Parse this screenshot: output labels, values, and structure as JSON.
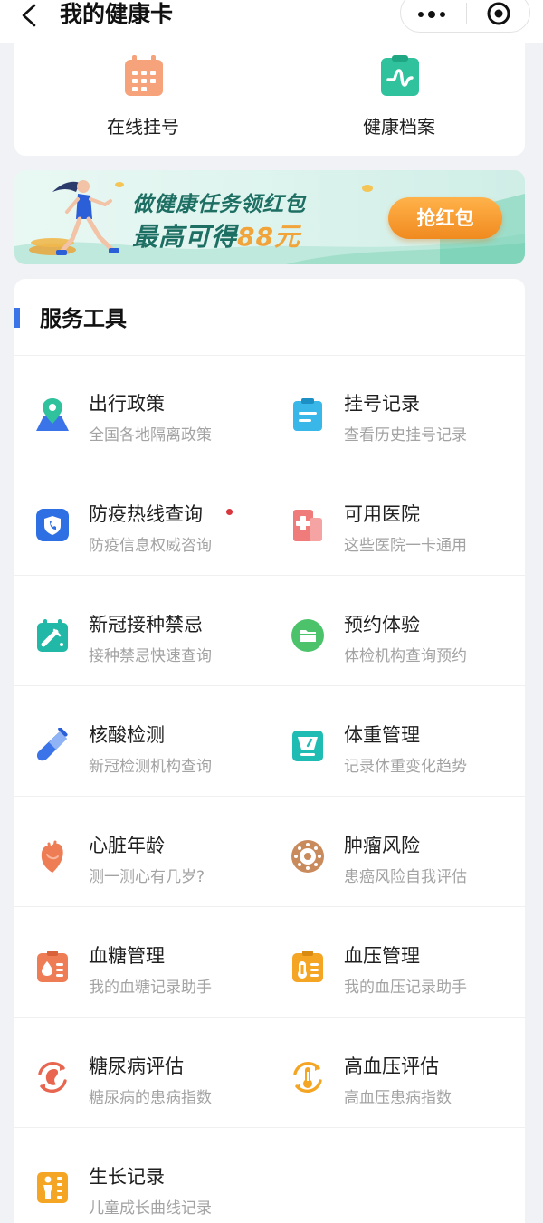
{
  "nav": {
    "title": "我的健康卡"
  },
  "quick": [
    {
      "label": "在线挂号",
      "icon": "calendar-icon",
      "color": "#f6a27a"
    },
    {
      "label": "健康档案",
      "icon": "health-record-icon",
      "color": "#2fc29d"
    }
  ],
  "banner": {
    "line1": "做健康任务领红包",
    "line2_prefix": "最高可得",
    "line2_amount": "88元",
    "button": "抢红包"
  },
  "tools": {
    "title": "服务工具",
    "items": [
      {
        "name": "出行政策",
        "desc": "全国各地隔离政策",
        "icon": "map-pin-icon",
        "color": "#3b73e8"
      },
      {
        "name": "挂号记录",
        "desc": "查看历史挂号记录",
        "icon": "clipboard-icon",
        "color": "#39b7e8"
      },
      {
        "name": "防疫热线查询",
        "desc": "防疫信息权威咨询",
        "icon": "phone-shield-icon",
        "color": "#2f6fe4",
        "dot": true
      },
      {
        "name": "可用医院",
        "desc": "这些医院一卡通用",
        "icon": "hospital-icon",
        "color": "#f07b7b"
      },
      {
        "name": "新冠接种禁忌",
        "desc": "接种禁忌快速查询",
        "icon": "vaccine-calendar-icon",
        "color": "#21b8a8"
      },
      {
        "name": "预约体验",
        "desc": "体检机构查询预约",
        "icon": "folder-icon",
        "color": "#4cc36a"
      },
      {
        "name": "核酸检测",
        "desc": "新冠检测机构查询",
        "icon": "test-tube-icon",
        "color": "#3b73e8"
      },
      {
        "name": "体重管理",
        "desc": "记录体重变化趋势",
        "icon": "scale-icon",
        "color": "#1fbcb4"
      },
      {
        "name": "心脏年龄",
        "desc": "测一测心有几岁?",
        "icon": "heart-icon",
        "color": "#ee7d55"
      },
      {
        "name": "肿瘤风险",
        "desc": "患癌风险自我评估",
        "icon": "cell-icon",
        "color": "#c98a5c"
      },
      {
        "name": "血糖管理",
        "desc": "我的血糖记录助手",
        "icon": "blood-sugar-icon",
        "color": "#ee7d55"
      },
      {
        "name": "血压管理",
        "desc": "我的血压记录助手",
        "icon": "blood-pressure-icon",
        "color": "#f5a524"
      },
      {
        "name": "糖尿病评估",
        "desc": "糖尿病的患病指数",
        "icon": "kidney-cycle-icon",
        "color": "#e8654f"
      },
      {
        "name": "高血压评估",
        "desc": "高血压患病指数",
        "icon": "thermometer-cycle-icon",
        "color": "#f5a524"
      },
      {
        "name": "生长记录",
        "desc": "儿童成长曲线记录",
        "icon": "growth-chart-icon",
        "color": "#f5a524"
      }
    ]
  }
}
